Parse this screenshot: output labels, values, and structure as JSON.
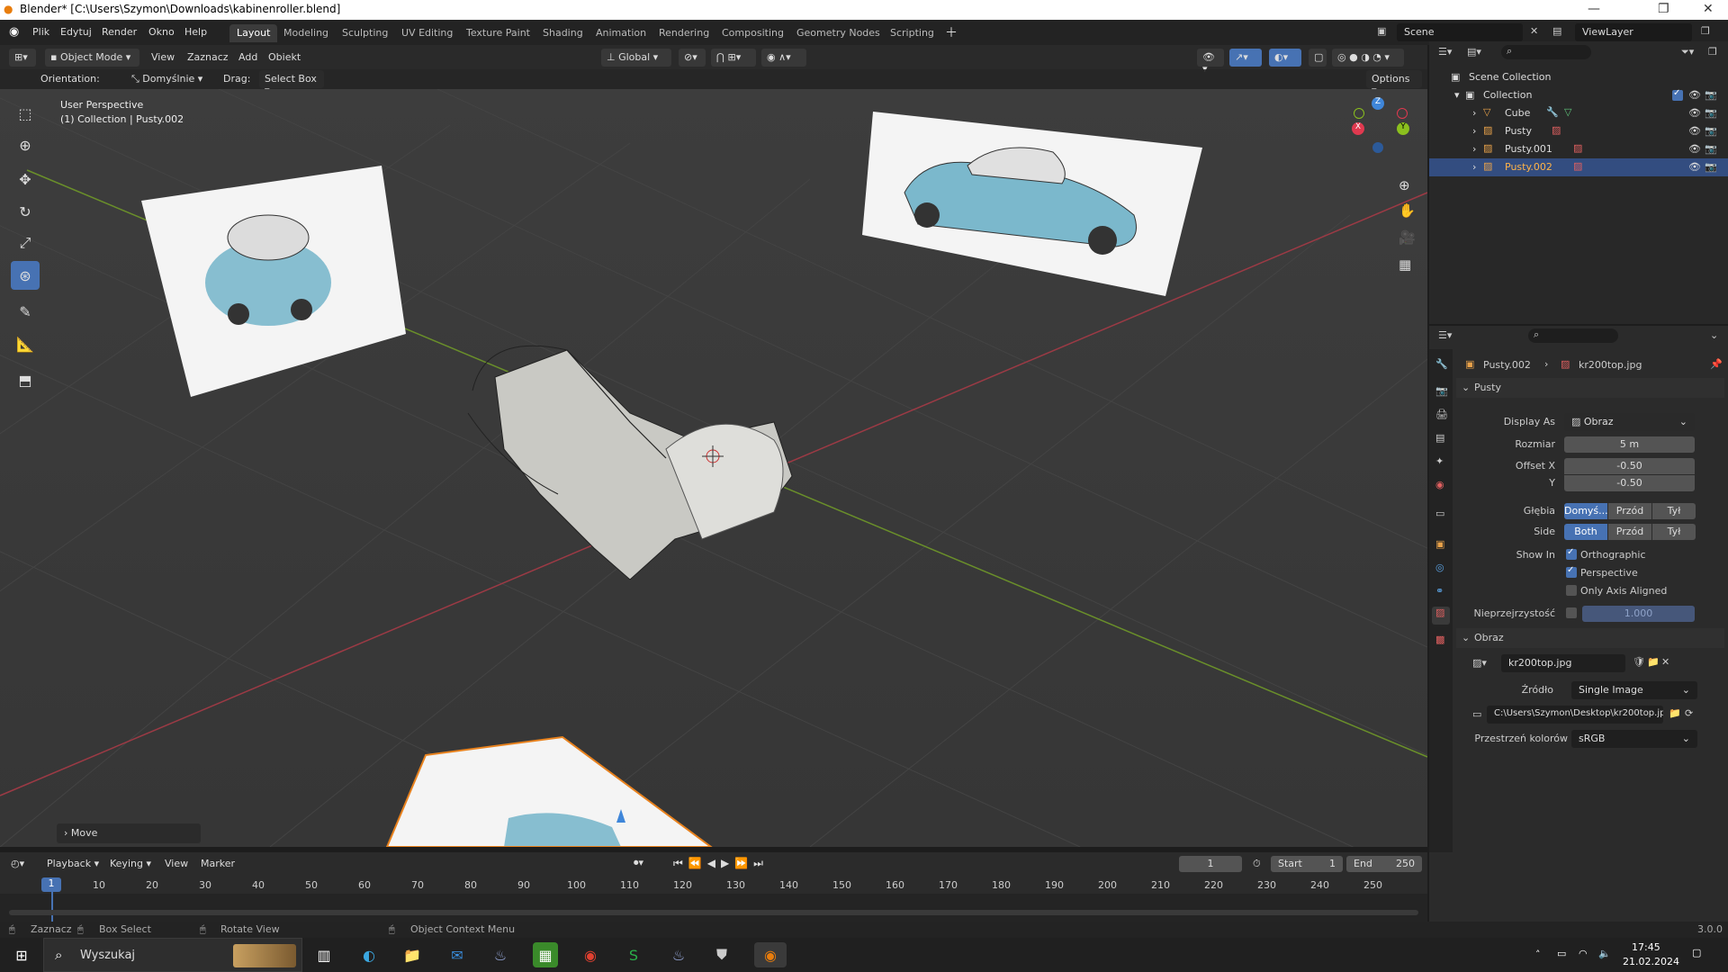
{
  "window": {
    "title": "Blender* [C:\\Users\\Szymon\\Downloads\\kabinenroller.blend]",
    "min": "—",
    "max": "❐",
    "close": "✕"
  },
  "menu": [
    "Plik",
    "Edytuj",
    "Render",
    "Okno",
    "Help"
  ],
  "workspaces": [
    "Layout",
    "Modeling",
    "Sculpting",
    "UV Editing",
    "Texture Paint",
    "Shading",
    "Animation",
    "Rendering",
    "Compositing",
    "Geometry Nodes",
    "Scripting"
  ],
  "scene": {
    "name": "Scene",
    "view_layer": "ViewLayer"
  },
  "viewport_header": {
    "mode": "Object Mode",
    "view": "View",
    "select": "Zaznacz",
    "add": "Add",
    "object": "Obiekt",
    "transform": "Global",
    "orientation_label": "Orientation:",
    "orientation": "Domyślnie",
    "drag_label": "Drag:",
    "drag": "Select Box",
    "options": "Options"
  },
  "viewport": {
    "view_name": "User Perspective",
    "collection_info": "(1) Collection | Pusty.002",
    "last_op": "Move"
  },
  "gizmo": {
    "x": "X",
    "y": "Y",
    "z": "Z"
  },
  "outliner": {
    "root": "Scene Collection",
    "collection": "Collection",
    "items": [
      "Cube",
      "Pusty",
      "Pusty.001",
      "Pusty.002"
    ]
  },
  "properties": {
    "breadcrumb_obj": "Pusty.002",
    "breadcrumb_data": "kr200top.jpg",
    "panel_empty": "Pusty",
    "display_as_label": "Display As",
    "display_as": "Obraz",
    "size_label": "Rozmiar",
    "size": "5 m",
    "offset_x_label": "Offset X",
    "offset_x": "-0.50",
    "offset_y_label": "Y",
    "offset_y": "-0.50",
    "depth_label": "Głębia",
    "depth_opts": [
      "Domyś...",
      "Przód",
      "Tył"
    ],
    "side_label": "Side",
    "side_opts": [
      "Both",
      "Przód",
      "Tył"
    ],
    "show_in_label": "Show In",
    "orthographic": "Orthographic",
    "perspective": "Perspective",
    "axis_aligned": "Only Axis Aligned",
    "opacity_label": "Nieprzejrzystość",
    "opacity": "1.000",
    "panel_image": "Obraz",
    "image_name": "kr200top.jpg",
    "source_label": "Źródło",
    "source": "Single Image",
    "filepath": "C:\\Users\\Szymon\\Desktop\\kr200top.jpg",
    "colorspace_label": "Przestrzeń kolorów",
    "colorspace": "sRGB"
  },
  "timeline": {
    "playback": "Playback",
    "keying": "Keying",
    "view": "View",
    "marker": "Marker",
    "current": "1",
    "start_label": "Start",
    "start": "1",
    "end_label": "End",
    "end": "250",
    "ticks": [
      "1",
      "10",
      "20",
      "30",
      "40",
      "50",
      "60",
      "70",
      "80",
      "90",
      "100",
      "110",
      "120",
      "130",
      "140",
      "150",
      "160",
      "170",
      "180",
      "190",
      "200",
      "210",
      "220",
      "230",
      "240",
      "250"
    ]
  },
  "status": {
    "select": "Zaznacz",
    "box_select": "Box Select",
    "rotate": "Rotate View",
    "context": "Object Context Menu",
    "version": "3.0.0"
  },
  "taskbar": {
    "search": "Wyszukaj",
    "time": "17:45",
    "date": "21.02.2024"
  }
}
